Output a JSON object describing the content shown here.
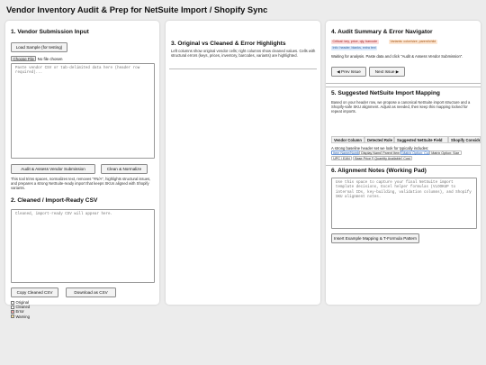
{
  "app": {
    "title": "Vendor Inventory Audit & Prep for NetSuite Import / Shopify Sync"
  },
  "submission": {
    "heading": "1. Vendor Submission Input",
    "load_sample_label": "Load Sample (for testing)",
    "choose_file_label": "Choose File",
    "no_file_label": "No file chosen",
    "input_placeholder": "Paste vendor CSV or tab-delimited data here (header row required)...",
    "audit_button": "Audit & Assess Vendor Submission",
    "clean_button": "Clean & Normalize",
    "description": "This tool trims spaces, normalizes text, removes \"#N/A\", highlights structural issues, and prepares a strong NetSuite-ready import that keeps SKUs aligned with Shopify variants."
  },
  "cleaned": {
    "heading": "2. Cleaned / Import-Ready CSV",
    "output_placeholder": "Cleaned, import-ready CSV will appear here.",
    "copy_button": "Copy Cleaned CSV",
    "download_button": "Download as CSV",
    "legend": [
      {
        "label": "Original",
        "color": "#ffffff"
      },
      {
        "label": "Cleaned",
        "color": "#ffffff"
      },
      {
        "label": "Error",
        "color": "#f4a7a7"
      },
      {
        "label": "Warning",
        "color": "#f6df9c"
      }
    ]
  },
  "comparison": {
    "heading": "3. Original vs Cleaned & Error Highlights",
    "description": "Left columns show original vendor cells; right columns show cleaned values. Cells with structural errors (keys, prices, inventory, barcodes, variants) are highlighted."
  },
  "audit": {
    "heading": "4. Audit Summary & Error Navigator",
    "badges": [
      {
        "label": "Critical: key, price, qty, barcode",
        "bg": "#fcdada",
        "fg": "#a02525"
      },
      {
        "label": "Variants: color/size, parent/child",
        "bg": "#fde6d2",
        "fg": "#a35512"
      },
      {
        "label": "Info: header, blanks, extra text",
        "bg": "#dbe9fb",
        "fg": "#2a5c9a"
      }
    ],
    "status": "Waiting for analysis. Paste data and click \"Audit & Assess Vendor Submission\".",
    "prev_button": "◀ Prev Issue",
    "next_button": "Next Issue ▶"
  },
  "mapping": {
    "heading": "5. Suggested NetSuite Import Mapping",
    "description": "Based on your header row, we propose a canonical NetSuite import structure and a Shopify-safe SKU alignment. Adjust as needed, then keep this mapping locked for repeat imports.",
    "columns": [
      "Vendor Column",
      "Detected Role",
      "Suggested NetSuite Field",
      "Shopify Considerations"
    ],
    "baseline_text": "A strong baseline header set we look for typically includes:",
    "fields": [
      "Item Name/Number",
      "Display Name",
      "Parent Item",
      "Matrix Option: Color",
      "Matrix Option: Size",
      "UPC / EAN",
      "Base Price",
      "Quantity Available",
      "Cost"
    ]
  },
  "notes": {
    "heading": "6. Alignment Notes (Working Pad)",
    "placeholder": "Use this space to capture your final NetSuite import template decisions, Excel helper formulas (VLOOKUP to internal IDs, key-building, validation columns), and Shopify SKU alignment notes.",
    "insert_button": "Insert Example Mapping & T-Formula Pattern"
  }
}
